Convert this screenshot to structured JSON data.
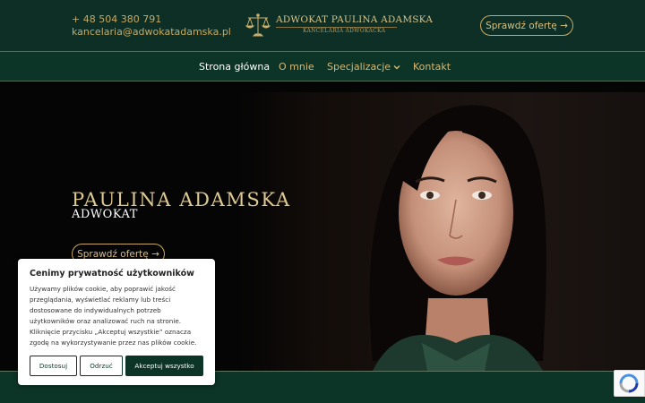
{
  "header": {
    "phone": "+ 48 504 380 791",
    "email": "kancelaria@adwokatadamska.pl",
    "logo_title": "ADWOKAT PAULINA ADAMSKA",
    "logo_subtitle": "KANCELARIA ADWOKACKA",
    "offer_button": "Sprawdź ofertę →"
  },
  "nav": {
    "items": [
      {
        "label": "Strona główna"
      },
      {
        "label": "O mnie"
      },
      {
        "label": "Specjalizacje"
      },
      {
        "label": "Kontakt"
      }
    ]
  },
  "hero": {
    "name": "PAULINA ADAMSKA",
    "role": "ADWOKAT",
    "offer_button": "Sprawdź ofertę →"
  },
  "cookie": {
    "title": "Cenimy prywatność użytkowników",
    "text": "Używamy plików cookie, aby poprawić jakość przeglądania, wyświetlać reklamy lub treści dostosowane do indywidualnych potrzeb użytkowników oraz analizować ruch na stronie. Kliknięcie przycisku „Akceptuj wszystkie” oznacza zgodę na wykorzystywanie przez nas plików cookie.",
    "buttons": {
      "customize": "Dostosuj",
      "reject": "Odrzuć",
      "accept": "Akceptuj wszystko"
    }
  },
  "colors": {
    "brand_green": "#0c3427",
    "gold": "#c9a861"
  },
  "icons": {
    "logo": "scales-of-justice-icon",
    "dropdown": "chevron-down-icon",
    "recaptcha": "recaptcha-icon"
  }
}
